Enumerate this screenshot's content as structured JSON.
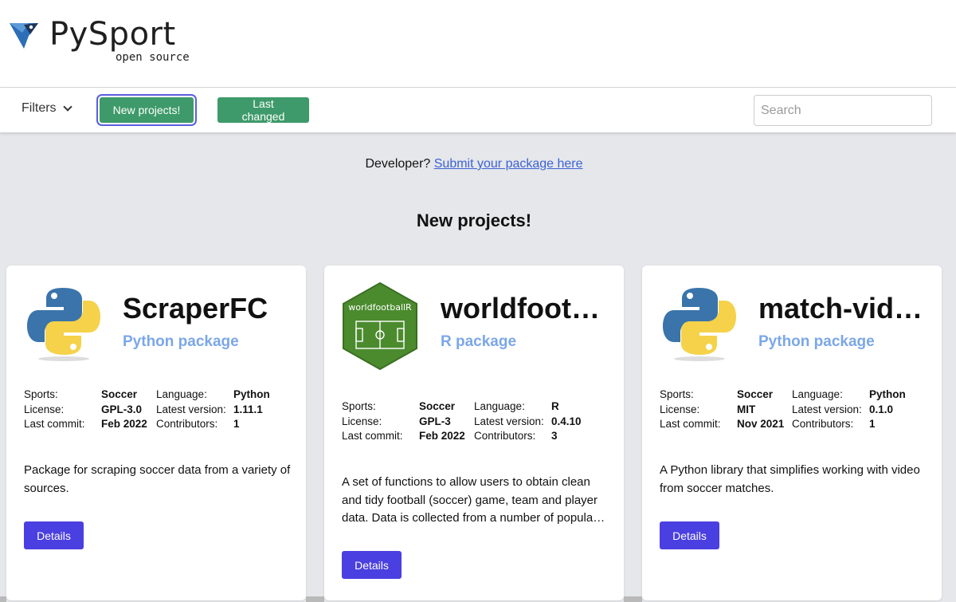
{
  "brand": {
    "title": "PySport",
    "subtitle": "open source",
    "colors": {
      "logo_blue": "#2d6eb7",
      "logo_dark": "#1d3557"
    }
  },
  "toolbar": {
    "filters_label": "Filters",
    "new_projects_label": "New projects!",
    "last_changed_label": "Last changed",
    "search_placeholder": "Search",
    "button_color": "#3e9a6a"
  },
  "intro": {
    "developer_text": "Developer?",
    "submit_link": "Submit your package here"
  },
  "section": {
    "title": "New projects!"
  },
  "cards": [
    {
      "name": "ScraperFC",
      "type": "Python package",
      "icon": "python-logo-icon",
      "sports": "Soccer",
      "license": "GPL-3.0",
      "last_commit": "Feb 2022",
      "language": "Python",
      "latest_version": "1.11.1",
      "contributors": "1",
      "description": "Package for scraping soccer data from a variety of sources.",
      "details_label": "Details"
    },
    {
      "name": "worldfootballR",
      "type": "R package",
      "icon": "worldfootballr-hex-logo-icon",
      "icon_text": "worldfootballR",
      "sports": "Soccer",
      "license": "GPL-3",
      "last_commit": "Feb 2022",
      "language": "R",
      "latest_version": "0.4.10",
      "contributors": "3",
      "description": "A set of functions to allow users to obtain clean and tidy football (soccer) game, team and player data. Data is collected from a number of popular sites.",
      "details_label": "Details"
    },
    {
      "name": "match-video",
      "type": "Python package",
      "icon": "python-logo-icon",
      "sports": "Soccer",
      "license": "MIT",
      "last_commit": "Nov 2021",
      "language": "Python",
      "latest_version": "0.1.0",
      "contributors": "1",
      "description": "A Python library that simplifies working with video from soccer matches.",
      "details_label": "Details"
    }
  ],
  "labels": {
    "sports": "Sports:",
    "license": "License:",
    "last_commit": "Last commit:",
    "language": "Language:",
    "latest_version": "Latest version:",
    "contributors": "Contributors:"
  },
  "accent_color": "#4a3fe0",
  "package_type_color": "#7ba7e8"
}
